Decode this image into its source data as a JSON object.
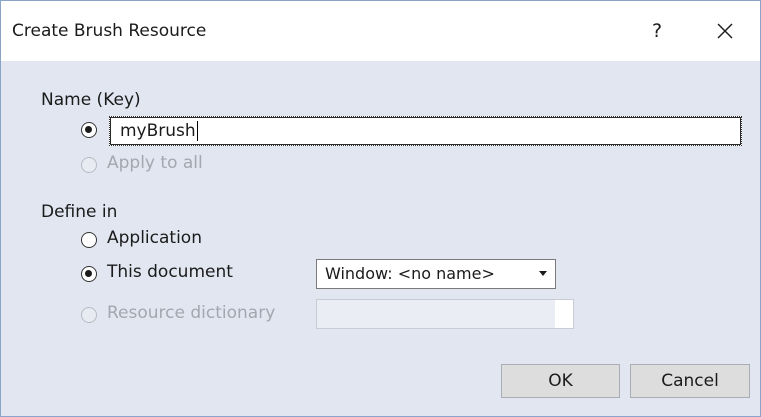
{
  "dialog": {
    "title": "Create Brush Resource",
    "help_label": "?"
  },
  "name_section": {
    "heading": "Name (Key)",
    "name_value": "myBrush",
    "apply_all_label": "Apply to all"
  },
  "define_section": {
    "heading": "Define in",
    "application_label": "Application",
    "this_document_label": "This document",
    "document_select_value": "Window: <no name>",
    "resource_dictionary_label": "Resource dictionary"
  },
  "buttons": {
    "ok_label": "OK",
    "cancel_label": "Cancel"
  }
}
